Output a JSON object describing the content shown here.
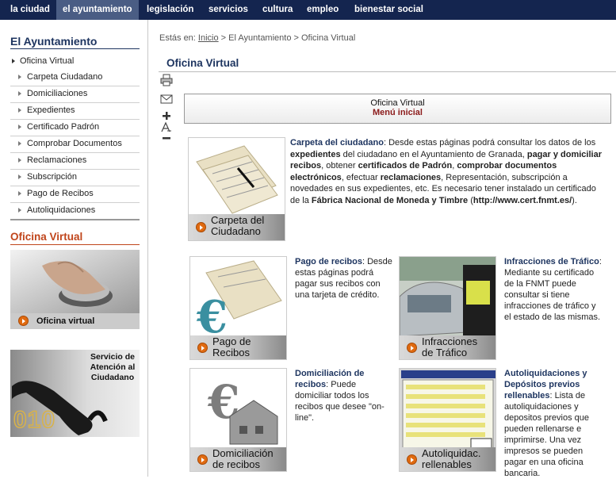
{
  "topnav": {
    "items": [
      {
        "label": "la ciudad"
      },
      {
        "label": "el ayuntamiento",
        "active": true
      },
      {
        "label": "legislación"
      },
      {
        "label": "servicios"
      },
      {
        "label": "cultura"
      },
      {
        "label": "empleo"
      },
      {
        "label": "bienestar social"
      }
    ]
  },
  "sidebar": {
    "heading": "El Ayuntamiento",
    "items": [
      {
        "label": "Oficina Virtual"
      },
      {
        "label": "Carpeta Ciudadano"
      },
      {
        "label": "Domiciliaciones"
      },
      {
        "label": "Expedientes"
      },
      {
        "label": "Certificado Padrón"
      },
      {
        "label": "Comprobar Documentos"
      },
      {
        "label": "Reclamaciones"
      },
      {
        "label": "Subscripción"
      },
      {
        "label": "Pago de Recibos"
      },
      {
        "label": "Autoliquidaciones"
      }
    ],
    "oficina_heading": "Oficina Virtual",
    "promo_oficina_caption": "Oficina virtual",
    "promo_servicio_text": "Servicio de Atención al Ciudadano",
    "promo_servicio_number": "010"
  },
  "breadcrumb": {
    "prefix": "Estás en:",
    "home": "Inicio",
    "sep1": " > ",
    "section": "El Ayuntamiento",
    "sep2": " > ",
    "current": "Oficina Virtual"
  },
  "page_title": "Oficina Virtual",
  "menu_box": {
    "title": "Oficina Virtual",
    "subtitle": "Menú inicial"
  },
  "tiles": {
    "carpeta": {
      "caption_1": "Carpeta del",
      "caption_2": "Ciudadano",
      "parts": [
        {
          "t": "Carpeta del ciudadano",
          "b": true,
          "hl": true
        },
        {
          "t": ": Desde estas páginas podrá consultar los datos de los "
        },
        {
          "t": "expedientes",
          "b": true
        },
        {
          "t": " del ciudadano en el Ayuntamiento de Granada, "
        },
        {
          "t": "pagar y domiciliar recibos",
          "b": true
        },
        {
          "t": ", obtener "
        },
        {
          "t": "certificados de Padrón",
          "b": true
        },
        {
          "t": ", "
        },
        {
          "t": "comprobar documentos electrónicos",
          "b": true
        },
        {
          "t": ", efectuar "
        },
        {
          "t": "reclamaciones",
          "b": true
        },
        {
          "t": ", Representación, subscripción a novedades en sus expedientes, etc. Es necesario tener instalado un certificado de la "
        },
        {
          "t": "Fábrica Nacional de Moneda y Timbre",
          "b": true
        },
        {
          "t": " ("
        },
        {
          "t": "http://www.cert.fnmt.es/",
          "b": true
        },
        {
          "t": ")."
        }
      ]
    },
    "pago": {
      "caption_1": "Pago de",
      "caption_2": "Recibos",
      "parts": [
        {
          "t": "Pago de recibos",
          "b": true,
          "hl": true
        },
        {
          "t": ": Desde estas páginas podrá pagar sus recibos con una tarjeta de crédito."
        }
      ]
    },
    "infracciones": {
      "caption_1": "Infracciones",
      "caption_2": "de Tráfico",
      "parts": [
        {
          "t": "Infracciones de Tráfico",
          "b": true,
          "hl": true
        },
        {
          "t": ": Mediante su certificado de la FNMT puede consultar si tiene infracciones de tráfico y el estado de las mismas."
        }
      ]
    },
    "domiciliacion": {
      "caption_1": "Domiciliación",
      "caption_2": "de recibos",
      "parts": [
        {
          "t": "Domiciliación de recibos",
          "b": true,
          "hl": true
        },
        {
          "t": ": Puede domiciliar todos los recibos que desee \"on-line\"."
        }
      ]
    },
    "autoliquidaciones": {
      "caption_1": "Autoliquidac.",
      "caption_2": "rellenables",
      "parts": [
        {
          "t": "Autoliquidaciones y Depósitos previos rellenables",
          "b": true,
          "hl": true
        },
        {
          "t": ": Lista de autoliquidaciones y depositos previos que pueden rellenarse e imprimirse. Una vez impresos se pueden pagar en una oficina bancaria."
        }
      ]
    }
  },
  "icons": {
    "print": "printer-icon",
    "mail": "envelope-icon",
    "zoom_in": "plus-icon",
    "font": "font-size-icon",
    "zoom_out": "minus-icon"
  },
  "colors": {
    "nav_bg": "#14254f",
    "nav_active": "#4a5d84",
    "heading": "#1e3560",
    "accent_red": "#8b1a1a",
    "orange": "#e06a10"
  }
}
